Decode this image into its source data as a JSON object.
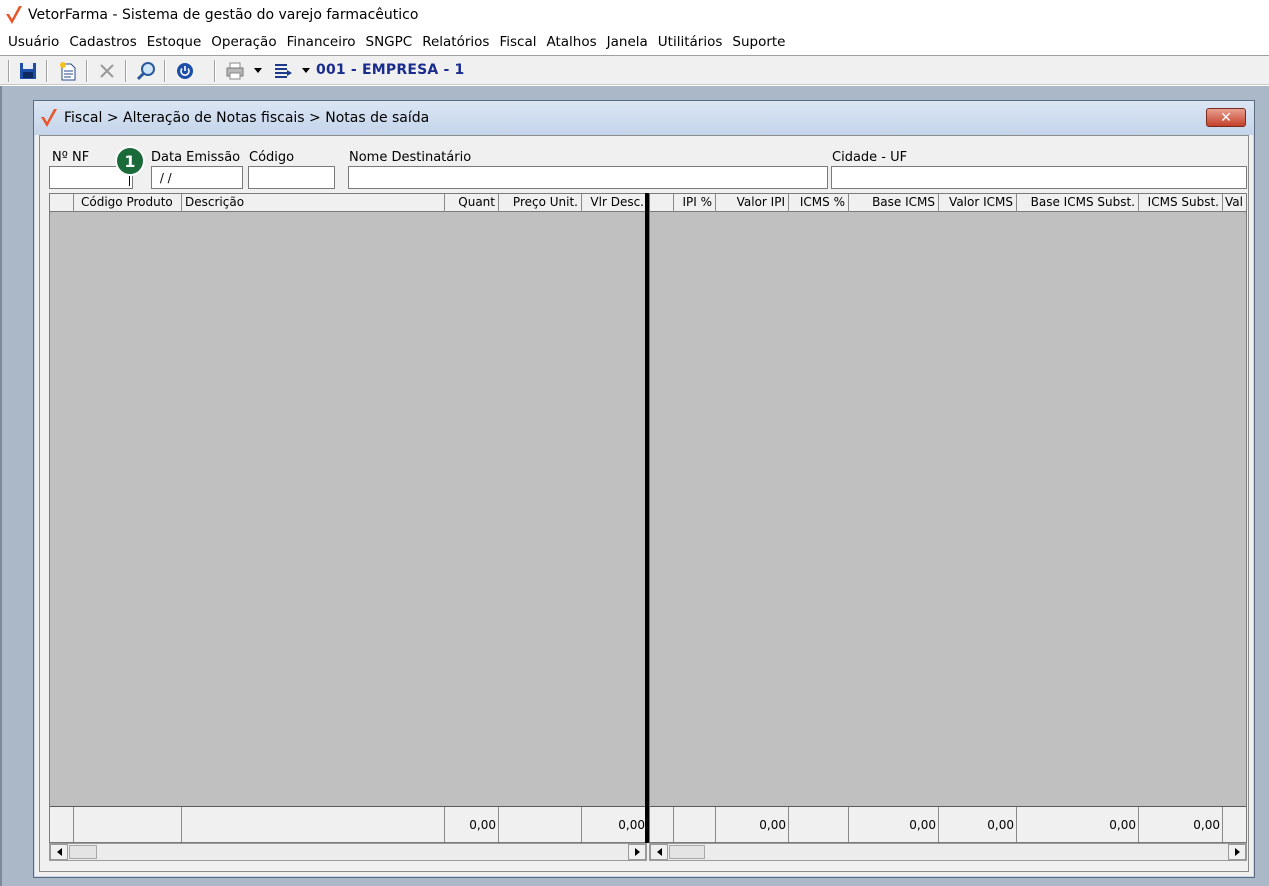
{
  "app": {
    "title": "VetorFarma - Sistema de gestão do varejo farmacêutico",
    "brand_color": "#e8562a"
  },
  "menu": [
    "Usuário",
    "Cadastros",
    "Estoque",
    "Operação",
    "Financeiro",
    "SNGPC",
    "Relatórios",
    "Fiscal",
    "Atalhos",
    "Janela",
    "Utilitários",
    "Suporte"
  ],
  "toolbar": {
    "company": "001 - EMPRESA - 1",
    "icons": [
      "save-icon",
      "new-document-icon",
      "delete-icon",
      "search-icon",
      "power-icon",
      "print-icon",
      "list-icon"
    ]
  },
  "window": {
    "title": "Fiscal > Alteração de Notas fiscais > Notas de saída",
    "close_label": "✕"
  },
  "filters": {
    "nf_label": "Nº NF",
    "nf_value": "",
    "badge": "1",
    "date_label": "Data Emissão",
    "date_value": " / /",
    "code_label": "Código",
    "code_value": "",
    "recipient_label": "Nome Destinatário",
    "recipient_value": "",
    "city_label": "Cidade - UF",
    "city_value": ""
  },
  "grid_left": {
    "columns": [
      "",
      "Código Produto",
      "Descrição",
      "Quant",
      "Preço Unit.",
      "Vlr Desc."
    ],
    "totals": [
      "",
      "",
      "",
      "0,00",
      "",
      "0,00"
    ]
  },
  "grid_right": {
    "columns": [
      "",
      "IPI %",
      "Valor IPI",
      "ICMS %",
      "Base ICMS",
      "Valor ICMS",
      "Base ICMS Subst.",
      "ICMS Subst.",
      "Val"
    ],
    "totals": [
      "",
      "",
      "0,00",
      "",
      "0,00",
      "0,00",
      "0,00",
      "0,00",
      ""
    ]
  }
}
